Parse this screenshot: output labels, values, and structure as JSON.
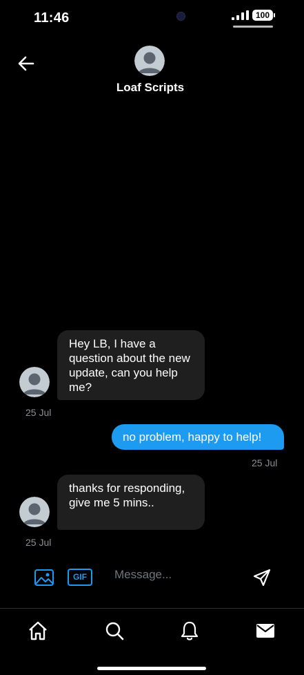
{
  "status_bar": {
    "time": "11:46",
    "battery": "100"
  },
  "header": {
    "name": "Loaf Scripts"
  },
  "messages": [
    {
      "direction": "in",
      "text": "Hey LB, I have a question about the new update, can you help me?",
      "time": "25 Jul"
    },
    {
      "direction": "out",
      "text": "no problem, happy to help!",
      "time": "25 Jul"
    },
    {
      "direction": "in",
      "text": "thanks for responding, give me 5 mins..",
      "time": "25 Jul"
    }
  ],
  "composer": {
    "gif_label": "GIF",
    "placeholder": "Message..."
  },
  "icons": {
    "back": "arrow-left-icon",
    "image": "image-icon",
    "send": "send-icon",
    "nav": [
      "home-icon",
      "search-icon",
      "bell-icon",
      "mail-icon"
    ]
  },
  "colors": {
    "accent": "#1d9bf0",
    "incoming_bubble": "#1f1f1f",
    "background": "#000000",
    "timestamp": "#8b8f94"
  }
}
